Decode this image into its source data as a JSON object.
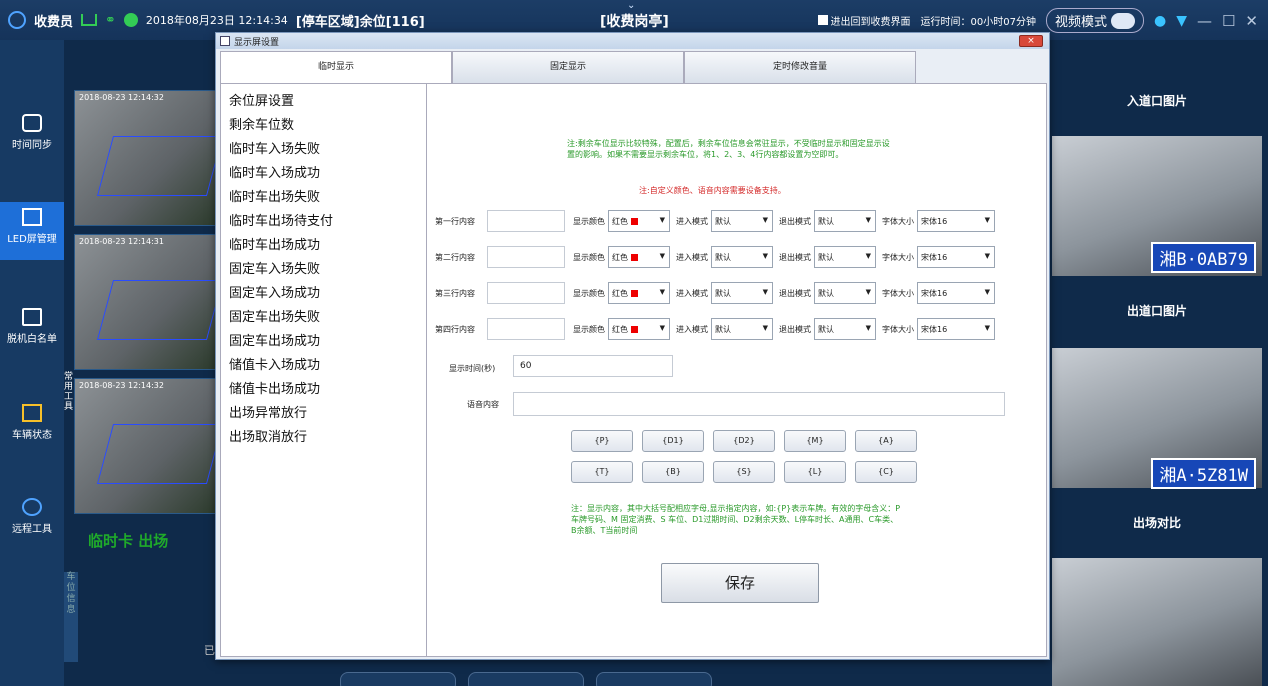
{
  "topbar": {
    "user": "收费员",
    "datetime": "2018年08月23日 12:14:34",
    "area": "[停车区域]余位[116]",
    "center_title": "[收费岗亭]",
    "return_label": "进出回到收费界面",
    "runtime": "运行时间：00小时07分钟",
    "mode": "视频模式",
    "chevron": "⌄"
  },
  "leftnav": {
    "items": [
      {
        "label": "时间同步"
      },
      {
        "label": "LED屏管理"
      },
      {
        "label": "脱机白名单"
      },
      {
        "label": "车辆状态"
      },
      {
        "label": "远程工具"
      }
    ]
  },
  "cams": {
    "timestamps": [
      "2018-08-23 12:14:32",
      "2018-08-23 12:14:31",
      "2018-08-23 12:14:32"
    ],
    "side_tab": "常用工具",
    "status_text": "临时卡 出场",
    "dim_tab": "车位信息",
    "dim_char": "已"
  },
  "right": {
    "entry_title": "入道口图片",
    "entry_plate": "湘B·0AB79",
    "exit_title": "出道口图片",
    "exit_plate": "湘A·5Z81W",
    "compare_title": "出场对比"
  },
  "dialog": {
    "title": "显示屏设置",
    "close": "×",
    "tabs": [
      "临时显示",
      "固定显示",
      "定时修改音量"
    ],
    "list": [
      "余位屏设置",
      "剩余车位数",
      "临时车入场失败",
      "临时车入场成功",
      "临时车出场失败",
      "临时车出场待支付",
      "临时车出场成功",
      "固定车入场失败",
      "固定车入场成功",
      "固定车出场失败",
      "固定车出场成功",
      "储值卡入场成功",
      "储值卡出场成功",
      "出场异常放行",
      "出场取消放行"
    ],
    "note1": "注:剩余车位显示比较特殊，配置后，剩余车位信息会常驻显示，不受临时显示和固定显示设置的影响。如果不需要显示剩余车位，将1、2、3、4行内容都设置为空即可。",
    "note2": "注:自定义颜色、语音内容需要设备支持。",
    "row_labels": [
      "第一行内容",
      "第二行内容",
      "第三行内容",
      "第四行内容"
    ],
    "color_label": "显示颜色",
    "color_value": "红色",
    "in_label": "进入模式",
    "in_value": "默认",
    "out_label": "退出模式",
    "out_value": "默认",
    "font_label": "字体大小",
    "font_value": "宋体16",
    "duration_label": "显示时间(秒)",
    "duration_value": "60",
    "voice_label": "语音内容",
    "macros": [
      "{P}",
      "{D1}",
      "{D2}",
      "{M}",
      "{A}",
      "{T}",
      "{B}",
      "{S}",
      "{L}",
      "{C}"
    ],
    "note3": "注：显示内容，其中大括号配相应字母,显示指定内容，如:{P}表示车牌。有效的字母含义：P 车牌号码、M 固定消费、S 车位、D1过期时间、D2剩余天数、L停车时长、A通用、C车类、B余额、T当前时间",
    "save": "保存"
  }
}
